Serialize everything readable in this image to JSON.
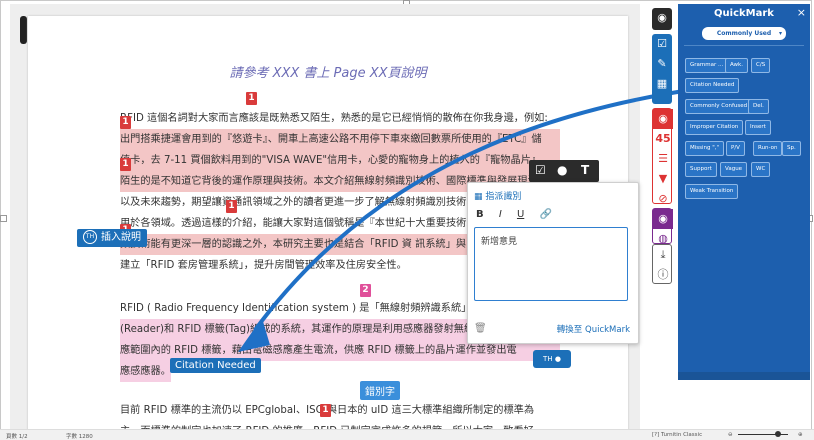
{
  "document": {
    "title": "請參考 XXX 書上 Page XX頁說明",
    "p1_lines": [
      "RFID 這個名詞對大家而言應該是既熟悉又陌生，熟悉的是它已經悄悄的散佈在你我身邊，例如:",
      "出門搭乘捷運會用到的『悠遊卡』、開車上高速公路不用停下車來繳回數票所使用的『ETC』儲",
      "值卡，去 7-11 買個飲料用到的\"VISA WAVE\"信用卡，心愛的寵物身上的植入的『寵物晶片』",
      "陌生的是不知道它背後的運作原理與技術。本文介紹無線射頻識別技術、國際標準與發展現況",
      "以及未來趨勢，期望讓資通訊領域之外的讀者更進一步了解無線射頻識別技術的運作原理與應",
      "用於各領域。透過這樣的介紹，能讓大家對這個號稱是『本世紀十大重要技術之一』的無線射",
      "頻技術能有更深一層的認識之外，本研究主要也是結合「RFID 資 訊系統」與「房屋管理」，",
      "建立「RFID 套房管理系統」，提升房間管理效率及住房安全性。"
    ],
    "p2_lines": [
      "RFID ( Radio Frequency Identification system ) 是「無線射頻辨識系統」，",
      "(Reader)和 RFID 標籤(Tag)組成的系統，其運作的原理是利用感應器發射無線電波，",
      "應範圍內的 RFID 標籤，藉由電磁感應產生電流，供應 RFID 標籤上的晶片運作並發出電",
      "應感應器。"
    ],
    "p3_lines": [
      "目前 RFID 標準的主流仍以 EPCglobal、ISO 與日本的 uID 這三大標準組織所制定的標準為",
      "主，而標準的制定也加速了 RFID 的推廣。RFID 已制定完成許多的規範，所以大家一致看好"
    ],
    "mark_numbers": [
      "1",
      "1",
      "1",
      "1",
      "1",
      "2",
      "1"
    ],
    "insert_comment_label": "插入說明",
    "avatar_initials": "TH",
    "citation_tag": "Citation Needed",
    "blue_tag": "錯別字"
  },
  "popup": {
    "toolbar_icons": [
      "check-icon",
      "comment-icon",
      "text-icon"
    ],
    "header_label": "指派識別",
    "format_buttons": [
      "B",
      "I",
      "U",
      "🔗"
    ],
    "editor_text": "新增意見",
    "convert_label": "轉換至 QuickMark",
    "avatar_initials": "TH"
  },
  "quickmark": {
    "title": "QuickMark",
    "set_select": "Commonly Used",
    "close": "×",
    "buttons": [
      [
        "Grammar ...",
        "Awk.",
        "C/S"
      ],
      [
        "Citation Needed"
      ],
      [
        "Commonly Confused",
        "Del."
      ],
      [
        "Improper Citation",
        "Insert"
      ],
      [
        "Missing \",\"",
        "P/V",
        "Run-on",
        "Sp."
      ],
      [
        "Support",
        "Vague",
        "WC"
      ],
      [
        "Weak Transition"
      ]
    ]
  },
  "tool_strip": {
    "grade_value": "45"
  },
  "status_bar": {
    "page": "頁數 1/2",
    "words": "字數 1280",
    "mode": "[?] Turnitin Classic"
  }
}
